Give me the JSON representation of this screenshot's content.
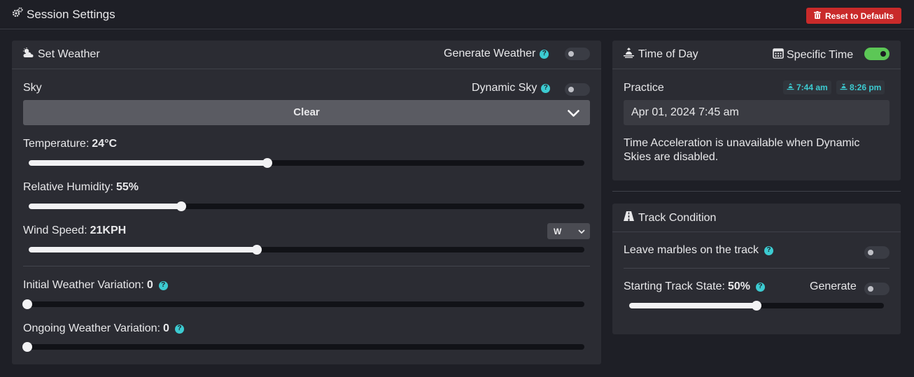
{
  "header": {
    "title": "Session Settings",
    "reset_label": "Reset to Defaults"
  },
  "weather": {
    "title": "Set Weather",
    "generate_label": "Generate Weather",
    "generate_on": false,
    "sky_label": "Sky",
    "dynamic_sky_label": "Dynamic Sky",
    "dynamic_sky_on": false,
    "sky_value": "Clear",
    "temperature_label": "Temperature:",
    "temperature_value": "24°C",
    "temperature_level": 0.43,
    "humidity_label": "Relative Humidity:",
    "humidity_value": "55%",
    "humidity_level": 0.275,
    "wind_label": "Wind Speed:",
    "wind_value": "21KPH",
    "wind_level": 0.41,
    "wind_direction": "W",
    "initial_var_label": "Initial Weather Variation:",
    "initial_var_value": "0",
    "initial_var_level": 0,
    "ongoing_var_label": "Ongoing Weather Variation:",
    "ongoing_var_value": "0",
    "ongoing_var_level": 0
  },
  "time": {
    "title": "Time of Day",
    "specific_label": "Specific Time",
    "specific_on": true,
    "session_label": "Practice",
    "sunrise": "7:44 am",
    "sunset": "8:26 pm",
    "datetime": "Apr 01, 2024 7:45 am",
    "note": "Time Acceleration is unavailable when Dynamic Skies are disabled."
  },
  "track": {
    "title": "Track Condition",
    "marbles_label": "Leave marbles on the track",
    "marbles_on": false,
    "state_label": "Starting Track State:",
    "state_value": "50%",
    "state_level": 0.5,
    "generate_label": "Generate",
    "generate_on": false
  },
  "colors": {
    "accent": "#3ccbd1",
    "danger": "#c92a2a",
    "toggle_on": "#5cc756"
  }
}
